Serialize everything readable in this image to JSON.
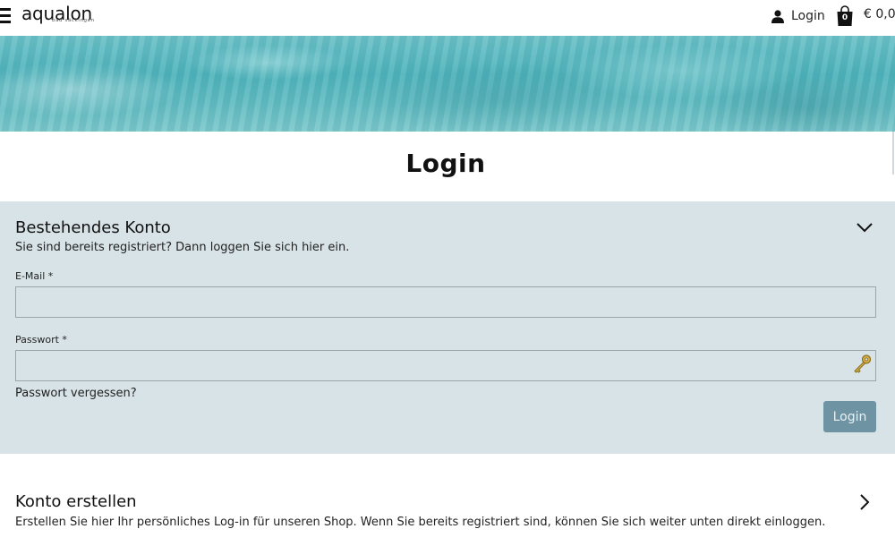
{
  "header": {
    "logo_name": "aqualon",
    "logo_sub": "bad säckingen",
    "login_label": "Login",
    "cart_count": "0",
    "cart_total": "€ 0,0",
    "icons": [
      "menu-icon",
      "user-icon",
      "shopping-bag-icon"
    ]
  },
  "page": {
    "title": "Login"
  },
  "existing_account": {
    "title": "Bestehendes Konto",
    "subtitle": "Sie sind bereits registriert? Dann loggen Sie sich hier ein.",
    "email_label": "E-Mail *",
    "email_value": "",
    "password_label": "Passwort *",
    "password_value": "",
    "forgot_label": "Passwort vergessen?",
    "submit_label": "Login",
    "submit_color": "#6e93a3",
    "panel_color": "#d8e3e7",
    "icons": [
      "chevron-down-icon",
      "key-icon"
    ]
  },
  "create_account": {
    "title": "Konto erstellen",
    "subtitle": "Erstellen Sie hier Ihr persönliches Log-in für unseren Shop. Wenn Sie bereits registriert sind, können Sie sich weiter unten direkt einloggen.",
    "icons": [
      "chevron-right-icon"
    ]
  }
}
